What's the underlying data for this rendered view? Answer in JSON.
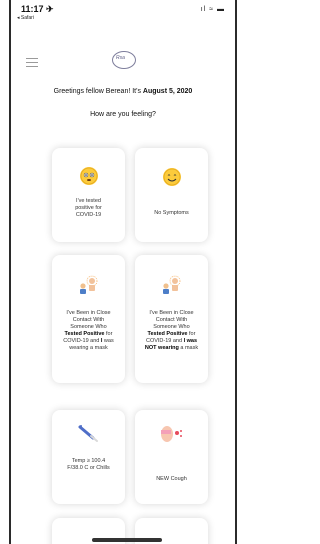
{
  "status": {
    "time": "11:17 ✈",
    "back_label": "◂ Safari",
    "icons": "ıl ≈ ▬"
  },
  "header": {
    "logo_text": "Rsa"
  },
  "greeting": {
    "prefix": "Greetings fellow Berean! It's ",
    "date": "August 5, 2020"
  },
  "question": "How are you feeling?",
  "cards": {
    "tested_positive": "I've tested positive for COVID-19",
    "no_symptoms": "No Symptoms",
    "contact_masked": {
      "pre": "I've Been in Close Contact With Someone Who ",
      "b1": "Tested Positive",
      "mid": " for COVID-19 and ",
      "b2": "I",
      "post": " was wearing a mask"
    },
    "contact_unmasked": {
      "pre": "I've Been in Close Contact With Someone Who ",
      "b1": "Tested Positive",
      "mid": " for COVID-19 and ",
      "b2": "I was NOT wearing",
      "post": " a mask"
    },
    "temperature": "Temp ≥ 100.4 F/38.0 C or Chills",
    "cough": "NEW Cough"
  }
}
